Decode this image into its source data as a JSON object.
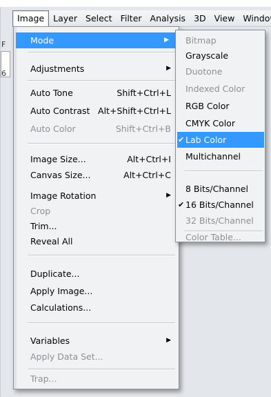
{
  "menubar": {
    "items": [
      {
        "label": "Image",
        "open": true
      },
      {
        "label": "Layer"
      },
      {
        "label": "Select"
      },
      {
        "label": "Filter"
      },
      {
        "label": "Analysis"
      },
      {
        "label": "3D"
      },
      {
        "label": "View"
      },
      {
        "label": "Window"
      }
    ]
  },
  "background": {
    "edge_glyphs": [
      "F",
      "6"
    ]
  },
  "image_menu": {
    "items": [
      {
        "label": "Mode",
        "submenu": true,
        "highlighted": true
      },
      {
        "label": "Adjustments",
        "submenu": true
      },
      {
        "label": "Auto Tone",
        "shortcut": "Shift+Ctrl+L"
      },
      {
        "label": "Auto Contrast",
        "shortcut": "Alt+Shift+Ctrl+L"
      },
      {
        "label": "Auto Color",
        "shortcut": "Shift+Ctrl+B",
        "disabled": true
      },
      {
        "label": "Image Size...",
        "shortcut": "Alt+Ctrl+I"
      },
      {
        "label": "Canvas Size...",
        "shortcut": "Alt+Ctrl+C"
      },
      {
        "label": "Image Rotation",
        "submenu": true
      },
      {
        "label": "Crop",
        "disabled": true
      },
      {
        "label": "Trim..."
      },
      {
        "label": "Reveal All"
      },
      {
        "label": "Duplicate..."
      },
      {
        "label": "Apply Image..."
      },
      {
        "label": "Calculations..."
      },
      {
        "label": "Variables",
        "submenu": true
      },
      {
        "label": "Apply Data Set...",
        "disabled": true
      },
      {
        "label": "Trap...",
        "disabled": true
      }
    ]
  },
  "mode_submenu": {
    "items": [
      {
        "label": "Bitmap",
        "disabled": true
      },
      {
        "label": "Grayscale"
      },
      {
        "label": "Duotone",
        "disabled": true
      },
      {
        "label": "Indexed Color",
        "disabled": true
      },
      {
        "label": "RGB Color"
      },
      {
        "label": "CMYK Color"
      },
      {
        "label": "Lab Color",
        "checked": true,
        "highlighted": true
      },
      {
        "label": "Multichannel"
      },
      {
        "label": "8 Bits/Channel"
      },
      {
        "label": "16 Bits/Channel",
        "checked": true
      },
      {
        "label": "32 Bits/Channel",
        "disabled": true
      },
      {
        "label": "Color Table...",
        "disabled": true
      }
    ]
  },
  "glyphs": {
    "arrow": "▶",
    "check": "✔"
  },
  "colors": {
    "highlight": "#3399ff",
    "disabled_text": "#8d9096",
    "menu_bg": "#f1f2f4"
  }
}
